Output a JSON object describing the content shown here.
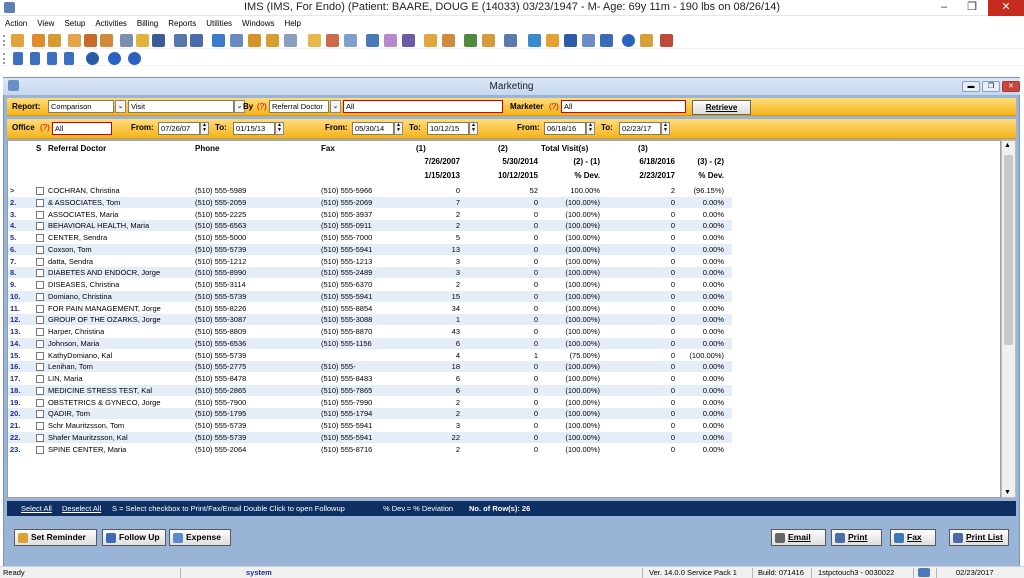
{
  "window": {
    "title": "IMS (IMS, For Endo)    (Patient: BAARE, DOUG E (14033) 03/23/1947 - M- Age: 69y 11m  - 190 lbs on 08/26/14)",
    "min": "–",
    "max": "❐",
    "close": "✕"
  },
  "menu": [
    "Action",
    "View",
    "Setup",
    "Activities",
    "Billing",
    "Reports",
    "Utilities",
    "Windows",
    "Help"
  ],
  "child": {
    "title": "Marketing",
    "min": "▬",
    "max": "❐",
    "close": "✕"
  },
  "filters": {
    "report_label": "Report:",
    "report_value": "Comparison",
    "type_value": "Visit",
    "by_label": "By",
    "by_value": "Referral Doctor",
    "by_extra": "All",
    "marketer_label": "Marketer",
    "marketer_value": "All",
    "retrieve_label": "Retrieve",
    "q": "(?)",
    "office_label": "Office",
    "office_value": "All",
    "from_label": "From:",
    "to_label": "To:",
    "range1_from": "07/26/07",
    "range1_to": "01/15/13",
    "range2_from": "05/30/14",
    "range2_to": "10/12/15",
    "range3_from": "06/18/16",
    "range3_to": "02/23/17"
  },
  "columns": {
    "s": "S",
    "doctor": "Referral Doctor",
    "phone": "Phone",
    "fax": "Fax",
    "c1_top": "(1)",
    "c1_from": "7/26/2007",
    "c1_to": "1/15/2013",
    "c2_top": "(2)",
    "c2_from": "5/30/2014",
    "c2_to": "10/12/2015",
    "tv_top": "Total Visit(s)",
    "tv_mid": "(2) - (1)",
    "tv_bot": "% Dev.",
    "c3_top": "(3)",
    "c3_from": "6/18/2016",
    "c3_to": "2/23/2017",
    "d_mid": "(3) - (2)",
    "d_bot": "% Dev."
  },
  "rows": [
    {
      "n": ">",
      "name": "COCHRAN, Christina",
      "phone": "(510) 555-5989",
      "fax": "(510) 555-5966",
      "c1": "0",
      "c2": "52",
      "dev1": "100.00%",
      "c3": "2",
      "dev2": "(96.15%)"
    },
    {
      "n": "2.",
      "name": "& ASSOCIATES, Tom",
      "phone": "(510) 555-2059",
      "fax": "(510) 555-2069",
      "c1": "7",
      "c2": "0",
      "dev1": "(100.00%)",
      "c3": "0",
      "dev2": "0.00%"
    },
    {
      "n": "3.",
      "name": "ASSOCIATES, Maria",
      "phone": "(510) 555-2225",
      "fax": "(510) 555-3937",
      "c1": "2",
      "c2": "0",
      "dev1": "(100.00%)",
      "c3": "0",
      "dev2": "0.00%"
    },
    {
      "n": "4.",
      "name": "BEHAVIORAL HEALTH, Maria",
      "phone": "(510) 555-6563",
      "fax": "(510) 555-0911",
      "c1": "2",
      "c2": "0",
      "dev1": "(100.00%)",
      "c3": "0",
      "dev2": "0.00%"
    },
    {
      "n": "5.",
      "name": "CENTER, Sendra",
      "phone": "(510) 555-5000",
      "fax": "(510) 555-7000",
      "c1": "5",
      "c2": "0",
      "dev1": "(100.00%)",
      "c3": "0",
      "dev2": "0.00%"
    },
    {
      "n": "6.",
      "name": "Coxson, Tom",
      "phone": "(510) 555-5739",
      "fax": "(510) 555-5941",
      "c1": "13",
      "c2": "0",
      "dev1": "(100.00%)",
      "c3": "0",
      "dev2": "0.00%"
    },
    {
      "n": "7.",
      "name": "datta, Sendra",
      "phone": "(510) 555-1212",
      "fax": "(510) 555-1213",
      "c1": "3",
      "c2": "0",
      "dev1": "(100.00%)",
      "c3": "0",
      "dev2": "0.00%"
    },
    {
      "n": "8.",
      "name": "DIABETES AND ENDOCR, Jorge",
      "phone": "(510) 555-8990",
      "fax": "(510) 555-2489",
      "c1": "3",
      "c2": "0",
      "dev1": "(100.00%)",
      "c3": "0",
      "dev2": "0.00%"
    },
    {
      "n": "9.",
      "name": "DISEASES, Christina",
      "phone": "(510) 555-3114",
      "fax": "(510) 555-6370",
      "c1": "2",
      "c2": "0",
      "dev1": "(100.00%)",
      "c3": "0",
      "dev2": "0.00%"
    },
    {
      "n": "10.",
      "name": "Domiano, Christina",
      "phone": "(510) 555-5739",
      "fax": "(510) 555-5941",
      "c1": "15",
      "c2": "0",
      "dev1": "(100.00%)",
      "c3": "0",
      "dev2": "0.00%"
    },
    {
      "n": "11.",
      "name": "FOR PAIN MANAGEMENT, Jorge",
      "phone": "(510) 555-8226",
      "fax": "(510) 555-8854",
      "c1": "34",
      "c2": "0",
      "dev1": "(100.00%)",
      "c3": "0",
      "dev2": "0.00%"
    },
    {
      "n": "12.",
      "name": "GROUP OF THE OZARKS, Jorge",
      "phone": "(510) 555-3087",
      "fax": "(510) 555-3088",
      "c1": "1",
      "c2": "0",
      "dev1": "(100.00%)",
      "c3": "0",
      "dev2": "0.00%"
    },
    {
      "n": "13.",
      "name": "Harper, Christina",
      "phone": "(510) 555-8809",
      "fax": "(510) 555-8870",
      "c1": "43",
      "c2": "0",
      "dev1": "(100.00%)",
      "c3": "0",
      "dev2": "0.00%"
    },
    {
      "n": "14.",
      "name": "Johnson, Maria",
      "phone": "(510) 555-6536",
      "fax": "(510) 555-1156",
      "c1": "6",
      "c2": "0",
      "dev1": "(100.00%)",
      "c3": "0",
      "dev2": "0.00%"
    },
    {
      "n": "15.",
      "name": "KathyDomiano, Kal",
      "phone": "(510) 555-5739",
      "fax": "",
      "c1": "4",
      "c2": "1",
      "dev1": "(75.00%)",
      "c3": "0",
      "dev2": "(100.00%)"
    },
    {
      "n": "16.",
      "name": "Lenihan, Tom",
      "phone": "(510) 555-2775",
      "fax": "(510) 555-",
      "c1": "18",
      "c2": "0",
      "dev1": "(100.00%)",
      "c3": "0",
      "dev2": "0.00%"
    },
    {
      "n": "17.",
      "name": "LIN, Maria",
      "phone": "(510) 555-8478",
      "fax": "(510) 555-8483",
      "c1": "6",
      "c2": "0",
      "dev1": "(100.00%)",
      "c3": "0",
      "dev2": "0.00%"
    },
    {
      "n": "18.",
      "name": "MEDICINE STRESS TEST, Kal",
      "phone": "(510) 555-2865",
      "fax": "(510) 555-7865",
      "c1": "6",
      "c2": "0",
      "dev1": "(100.00%)",
      "c3": "0",
      "dev2": "0.00%"
    },
    {
      "n": "19.",
      "name": "OBSTETRICS & GYNECO, Jorge",
      "phone": "(510) 555-7900",
      "fax": "(510) 555-7990",
      "c1": "2",
      "c2": "0",
      "dev1": "(100.00%)",
      "c3": "0",
      "dev2": "0.00%"
    },
    {
      "n": "20.",
      "name": "QADIR, Tom",
      "phone": "(510) 555-1795",
      "fax": "(510) 555-1794",
      "c1": "2",
      "c2": "0",
      "dev1": "(100.00%)",
      "c3": "0",
      "dev2": "0.00%"
    },
    {
      "n": "21.",
      "name": "Schr Mauritzsson, Tom",
      "phone": "(510) 555-5739",
      "fax": "(510) 555-5941",
      "c1": "3",
      "c2": "0",
      "dev1": "(100.00%)",
      "c3": "0",
      "dev2": "0.00%"
    },
    {
      "n": "22.",
      "name": "Shafer Mauritzsson, Kal",
      "phone": "(510) 555-5739",
      "fax": "(510) 555-5941",
      "c1": "22",
      "c2": "0",
      "dev1": "(100.00%)",
      "c3": "0",
      "dev2": "0.00%"
    },
    {
      "n": "23.",
      "name": "SPINE CENTER, Maria",
      "phone": "(510) 555-2064",
      "fax": "(510) 555-8716",
      "c1": "2",
      "c2": "0",
      "dev1": "(100.00%)",
      "c3": "0",
      "dev2": "0.00%"
    }
  ],
  "banner": {
    "select_all": "Select All",
    "deselect_all": "Deselect All",
    "hint": "S = Select checkbox to Print/Fax/Email  Double Click to open Followup",
    "legend": "% Dev.= % Deviation",
    "rows_label": "No. of Row(s): 26"
  },
  "buttons": {
    "set_reminder": "Set Reminder",
    "follow_up": "Follow Up",
    "expense": "Expense",
    "email": "Email",
    "print": "Print",
    "fax": "Fax",
    "print_list": "Print List"
  },
  "status": {
    "ready": "Ready",
    "user": "system",
    "version": "Ver. 14.0.0 Service Pack 1",
    "build": "Build: 071416",
    "station": "1stpctouch3 - 0030022",
    "date": "02/23/2017"
  },
  "colors": {
    "accent_orange": "#f4b41c",
    "banner_navy": "#0f2f63",
    "alt_row": "#e5eef8",
    "mdi_blue": "#9ab4d8"
  }
}
